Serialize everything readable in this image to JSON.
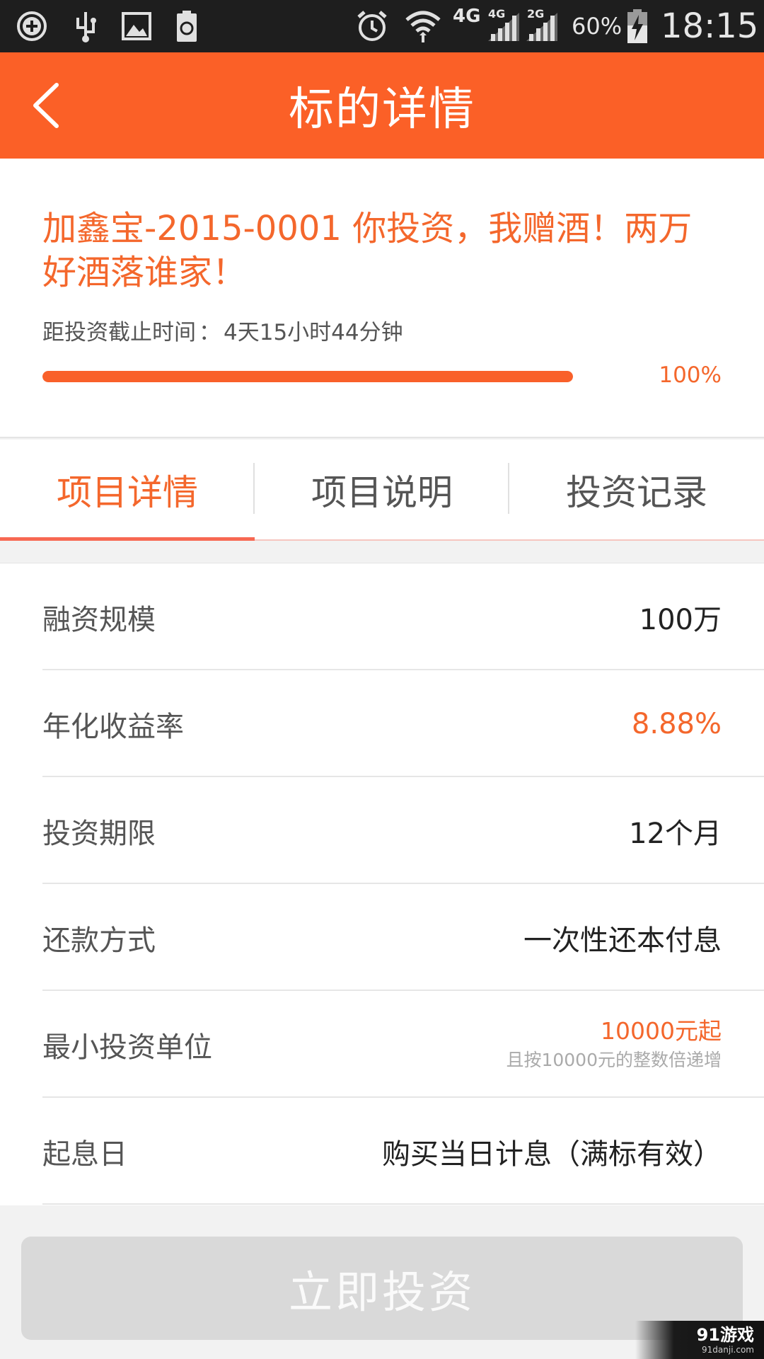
{
  "status_bar": {
    "icons": [
      "plus-circle-icon",
      "usb-icon",
      "image-icon",
      "battery-recycle-icon",
      "alarm-icon",
      "wifi-icon",
      "signal-4g-icon",
      "signal-2g-icon",
      "battery-charging-icon"
    ],
    "network_4g": "4G",
    "network_4g_small": "4G",
    "network_2g_small": "2G",
    "battery": "60%",
    "time": "18:15"
  },
  "app_bar": {
    "title": "标的详情",
    "back_icon": "chevron-left-icon"
  },
  "project": {
    "title": "加鑫宝-2015-0001 你投资，我赠酒！两万好酒落谁家！",
    "deadline_label": "距投资截止时间",
    "deadline_sep": "：",
    "deadline_value": "4天15小时44分钟",
    "progress_fraction": 1.0,
    "progress_text": "100%"
  },
  "tabs": [
    {
      "label": "项目详情",
      "active": true
    },
    {
      "label": "项目说明",
      "active": false
    },
    {
      "label": "投资记录",
      "active": false
    }
  ],
  "details": [
    {
      "label": "融资规模",
      "value": "100万"
    },
    {
      "label": "年化收益率",
      "value": "8.88%"
    },
    {
      "label": "投资期限",
      "value": "12个月"
    },
    {
      "label": "还款方式",
      "value": "一次性还本付息"
    },
    {
      "label": "最小投资单位",
      "value": "10000元起",
      "note": "且按10000元的整数倍递增"
    },
    {
      "label": "起息日",
      "value": "购买当日计息（满标有效）"
    }
  ],
  "invest_button": {
    "label": "立即投资"
  },
  "watermark": {
    "main": "91游戏",
    "sub": "91danji.com"
  },
  "colors": {
    "accent": "#fb6027",
    "accent_text": "#f4672c",
    "button_disabled": "#d9d9d9"
  }
}
